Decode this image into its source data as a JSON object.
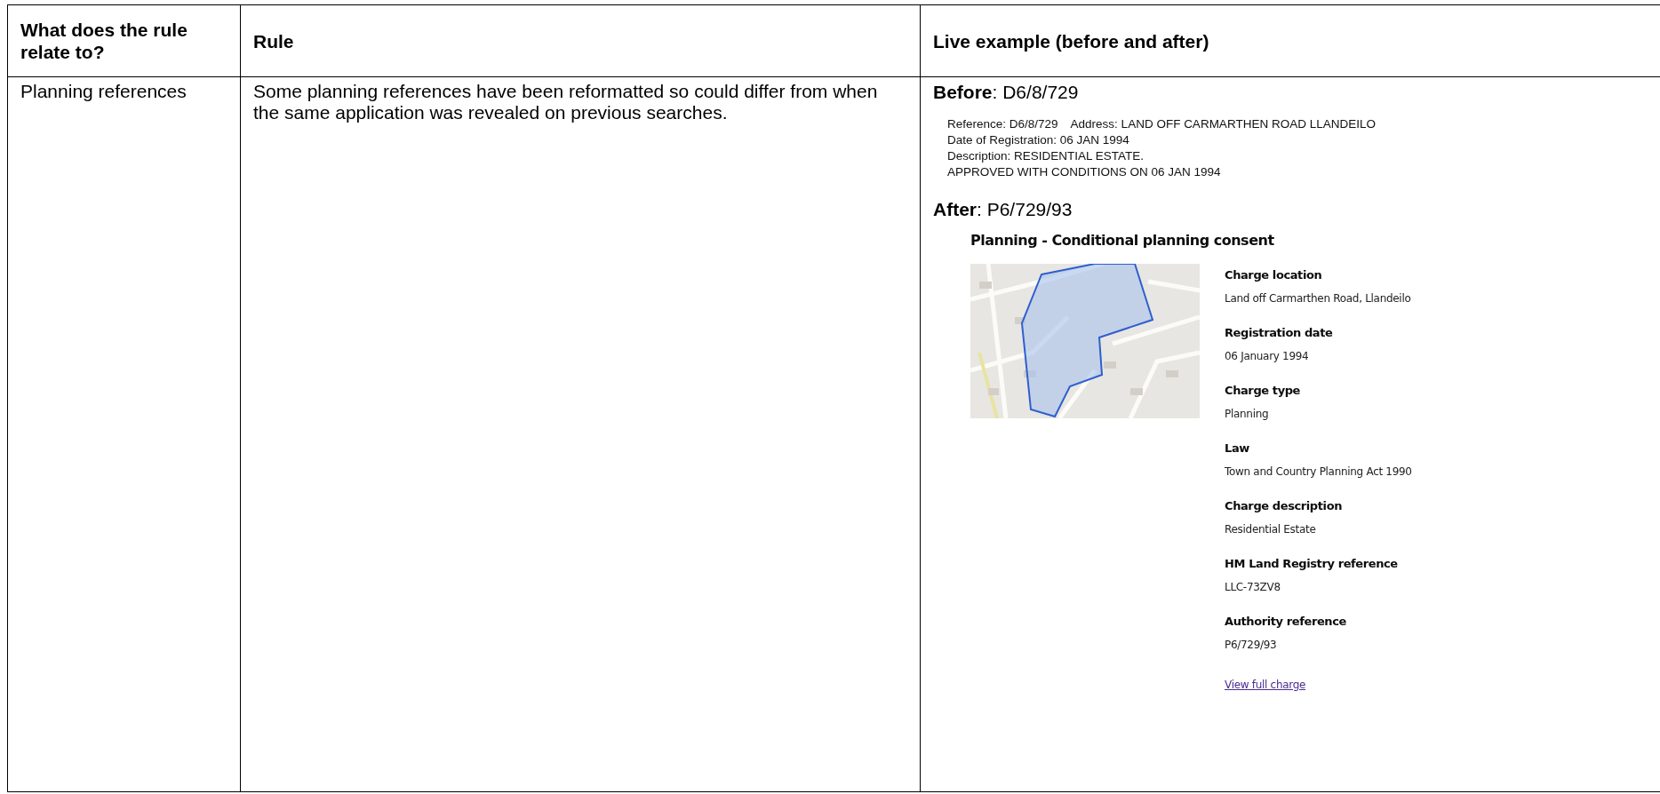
{
  "table": {
    "columns": [
      "What does the rule relate to?",
      "Rule",
      "Live example (before and after)"
    ],
    "rows": [
      {
        "subject": "Planning references",
        "rule": "Some planning references have been reformatted so could differ from when the same application was revealed on previous searches.",
        "before": {
          "heading": "**Before**: D6/8/729",
          "record_lines": [
            [
              "Reference: D6/8/729",
              "Address: LAND OFF CARMARTHEN ROAD LLANDEILO"
            ],
            [
              "Date of Registration: 06 JAN 1994"
            ],
            [
              "Description: RESIDENTIAL ESTATE."
            ],
            [
              "APPROVED WITH CONDITIONS ON 06 JAN 1994"
            ]
          ]
        },
        "after": {
          "heading": "**After**: P6/729/93",
          "charge_title": "Planning - Conditional planning consent",
          "fields": [
            {
              "label": "Charge location",
              "value": "Land off Carmarthen Road, Llandeilo"
            },
            {
              "label": "Registration date",
              "value": "06 January 1994"
            },
            {
              "label": "Charge type",
              "value": "Planning"
            },
            {
              "label": "Law",
              "value": "Town and Country Planning Act 1990"
            },
            {
              "label": "Charge description",
              "value": "Residential Estate"
            },
            {
              "label": "HM Land Registry reference",
              "value": "LLC-73ZV8"
            },
            {
              "label": "Authority reference",
              "value": "P6/729/93"
            }
          ],
          "link": "View full charge"
        }
      }
    ]
  }
}
